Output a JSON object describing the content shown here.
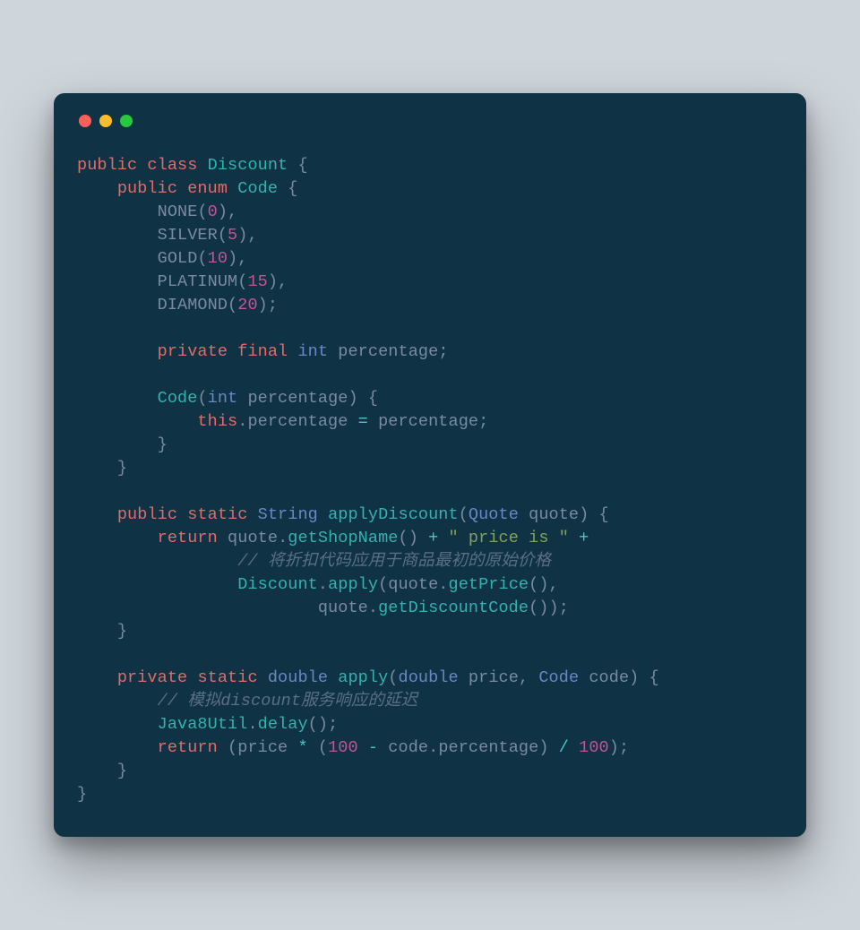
{
  "window": {
    "dots": {
      "red": "#ff5f56",
      "yellow": "#ffbd2e",
      "green": "#27c93f"
    }
  },
  "code": {
    "lines": [
      {
        "indent": 0,
        "tokens": [
          {
            "c": "kw",
            "t": "public"
          },
          {
            "c": "sp",
            "t": " "
          },
          {
            "c": "kw",
            "t": "class"
          },
          {
            "c": "sp",
            "t": " "
          },
          {
            "c": "cls",
            "t": "Discount"
          },
          {
            "c": "sp",
            "t": " "
          },
          {
            "c": "punct",
            "t": "{"
          }
        ]
      },
      {
        "indent": 1,
        "tokens": [
          {
            "c": "kw",
            "t": "public"
          },
          {
            "c": "sp",
            "t": " "
          },
          {
            "c": "kw",
            "t": "enum"
          },
          {
            "c": "sp",
            "t": " "
          },
          {
            "c": "cls",
            "t": "Code"
          },
          {
            "c": "sp",
            "t": " "
          },
          {
            "c": "punct",
            "t": "{"
          }
        ]
      },
      {
        "indent": 2,
        "tokens": [
          {
            "c": "enumc",
            "t": "NONE"
          },
          {
            "c": "punct",
            "t": "("
          },
          {
            "c": "num",
            "t": "0"
          },
          {
            "c": "punct",
            "t": "),"
          }
        ]
      },
      {
        "indent": 2,
        "tokens": [
          {
            "c": "enumc",
            "t": "SILVER"
          },
          {
            "c": "punct",
            "t": "("
          },
          {
            "c": "num",
            "t": "5"
          },
          {
            "c": "punct",
            "t": "),"
          }
        ]
      },
      {
        "indent": 2,
        "tokens": [
          {
            "c": "enumc",
            "t": "GOLD"
          },
          {
            "c": "punct",
            "t": "("
          },
          {
            "c": "num",
            "t": "10"
          },
          {
            "c": "punct",
            "t": "),"
          }
        ]
      },
      {
        "indent": 2,
        "tokens": [
          {
            "c": "enumc",
            "t": "PLATINUM"
          },
          {
            "c": "punct",
            "t": "("
          },
          {
            "c": "num",
            "t": "15"
          },
          {
            "c": "punct",
            "t": "),"
          }
        ]
      },
      {
        "indent": 2,
        "tokens": [
          {
            "c": "enumc",
            "t": "DIAMOND"
          },
          {
            "c": "punct",
            "t": "("
          },
          {
            "c": "num",
            "t": "20"
          },
          {
            "c": "punct",
            "t": ");"
          }
        ]
      },
      {
        "indent": 0,
        "tokens": [
          {
            "c": "sp",
            "t": " "
          }
        ]
      },
      {
        "indent": 2,
        "tokens": [
          {
            "c": "kw",
            "t": "private"
          },
          {
            "c": "sp",
            "t": " "
          },
          {
            "c": "kw",
            "t": "final"
          },
          {
            "c": "sp",
            "t": " "
          },
          {
            "c": "type",
            "t": "int"
          },
          {
            "c": "sp",
            "t": " "
          },
          {
            "c": "id",
            "t": "percentage"
          },
          {
            "c": "punct",
            "t": ";"
          }
        ]
      },
      {
        "indent": 0,
        "tokens": [
          {
            "c": "sp",
            "t": " "
          }
        ]
      },
      {
        "indent": 2,
        "tokens": [
          {
            "c": "cls",
            "t": "Code"
          },
          {
            "c": "punct",
            "t": "("
          },
          {
            "c": "type",
            "t": "int"
          },
          {
            "c": "sp",
            "t": " "
          },
          {
            "c": "id",
            "t": "percentage"
          },
          {
            "c": "punct",
            "t": ")"
          },
          {
            "c": "sp",
            "t": " "
          },
          {
            "c": "punct",
            "t": "{"
          }
        ]
      },
      {
        "indent": 3,
        "tokens": [
          {
            "c": "kw",
            "t": "this"
          },
          {
            "c": "punct",
            "t": "."
          },
          {
            "c": "id",
            "t": "percentage"
          },
          {
            "c": "sp",
            "t": " "
          },
          {
            "c": "op",
            "t": "="
          },
          {
            "c": "sp",
            "t": " "
          },
          {
            "c": "id",
            "t": "percentage"
          },
          {
            "c": "punct",
            "t": ";"
          }
        ]
      },
      {
        "indent": 2,
        "tokens": [
          {
            "c": "punct",
            "t": "}"
          }
        ]
      },
      {
        "indent": 1,
        "tokens": [
          {
            "c": "punct",
            "t": "}"
          }
        ]
      },
      {
        "indent": 0,
        "tokens": [
          {
            "c": "sp",
            "t": " "
          }
        ]
      },
      {
        "indent": 1,
        "tokens": [
          {
            "c": "kw",
            "t": "public"
          },
          {
            "c": "sp",
            "t": " "
          },
          {
            "c": "kw",
            "t": "static"
          },
          {
            "c": "sp",
            "t": " "
          },
          {
            "c": "type",
            "t": "String"
          },
          {
            "c": "sp",
            "t": " "
          },
          {
            "c": "fn",
            "t": "applyDiscount"
          },
          {
            "c": "punct",
            "t": "("
          },
          {
            "c": "type",
            "t": "Quote"
          },
          {
            "c": "sp",
            "t": " "
          },
          {
            "c": "id",
            "t": "quote"
          },
          {
            "c": "punct",
            "t": ")"
          },
          {
            "c": "sp",
            "t": " "
          },
          {
            "c": "punct",
            "t": "{"
          }
        ]
      },
      {
        "indent": 2,
        "tokens": [
          {
            "c": "kw",
            "t": "return"
          },
          {
            "c": "sp",
            "t": " "
          },
          {
            "c": "id",
            "t": "quote"
          },
          {
            "c": "punct",
            "t": "."
          },
          {
            "c": "fn",
            "t": "getShopName"
          },
          {
            "c": "punct",
            "t": "()"
          },
          {
            "c": "sp",
            "t": " "
          },
          {
            "c": "op",
            "t": "+"
          },
          {
            "c": "sp",
            "t": " "
          },
          {
            "c": "str",
            "t": "\" price is \""
          },
          {
            "c": "sp",
            "t": " "
          },
          {
            "c": "op",
            "t": "+"
          }
        ]
      },
      {
        "indent": 4,
        "tokens": [
          {
            "c": "cmt",
            "t": "// 将折扣代码应用于商品最初的原始价格"
          }
        ]
      },
      {
        "indent": 4,
        "tokens": [
          {
            "c": "cls",
            "t": "Discount"
          },
          {
            "c": "punct",
            "t": "."
          },
          {
            "c": "fn",
            "t": "apply"
          },
          {
            "c": "punct",
            "t": "("
          },
          {
            "c": "id",
            "t": "quote"
          },
          {
            "c": "punct",
            "t": "."
          },
          {
            "c": "fn",
            "t": "getPrice"
          },
          {
            "c": "punct",
            "t": "(),"
          }
        ]
      },
      {
        "indent": 6,
        "tokens": [
          {
            "c": "id",
            "t": "quote"
          },
          {
            "c": "punct",
            "t": "."
          },
          {
            "c": "fn",
            "t": "getDiscountCode"
          },
          {
            "c": "punct",
            "t": "());"
          }
        ]
      },
      {
        "indent": 1,
        "tokens": [
          {
            "c": "punct",
            "t": "}"
          }
        ]
      },
      {
        "indent": 0,
        "tokens": [
          {
            "c": "sp",
            "t": " "
          }
        ]
      },
      {
        "indent": 1,
        "tokens": [
          {
            "c": "kw",
            "t": "private"
          },
          {
            "c": "sp",
            "t": " "
          },
          {
            "c": "kw",
            "t": "static"
          },
          {
            "c": "sp",
            "t": " "
          },
          {
            "c": "type",
            "t": "double"
          },
          {
            "c": "sp",
            "t": " "
          },
          {
            "c": "fn",
            "t": "apply"
          },
          {
            "c": "punct",
            "t": "("
          },
          {
            "c": "type",
            "t": "double"
          },
          {
            "c": "sp",
            "t": " "
          },
          {
            "c": "id",
            "t": "price"
          },
          {
            "c": "punct",
            "t": ","
          },
          {
            "c": "sp",
            "t": " "
          },
          {
            "c": "type",
            "t": "Code"
          },
          {
            "c": "sp",
            "t": " "
          },
          {
            "c": "id",
            "t": "code"
          },
          {
            "c": "punct",
            "t": ")"
          },
          {
            "c": "sp",
            "t": " "
          },
          {
            "c": "punct",
            "t": "{"
          }
        ]
      },
      {
        "indent": 2,
        "tokens": [
          {
            "c": "cmt",
            "t": "// 模拟discount服务响应的延迟"
          }
        ]
      },
      {
        "indent": 2,
        "tokens": [
          {
            "c": "cls",
            "t": "Java8Util"
          },
          {
            "c": "punct",
            "t": "."
          },
          {
            "c": "fn",
            "t": "delay"
          },
          {
            "c": "punct",
            "t": "();"
          }
        ]
      },
      {
        "indent": 2,
        "tokens": [
          {
            "c": "kw",
            "t": "return"
          },
          {
            "c": "sp",
            "t": " "
          },
          {
            "c": "punct",
            "t": "("
          },
          {
            "c": "id",
            "t": "price"
          },
          {
            "c": "sp",
            "t": " "
          },
          {
            "c": "op",
            "t": "*"
          },
          {
            "c": "sp",
            "t": " "
          },
          {
            "c": "punct",
            "t": "("
          },
          {
            "c": "num",
            "t": "100"
          },
          {
            "c": "sp",
            "t": " "
          },
          {
            "c": "op",
            "t": "-"
          },
          {
            "c": "sp",
            "t": " "
          },
          {
            "c": "id",
            "t": "code"
          },
          {
            "c": "punct",
            "t": "."
          },
          {
            "c": "id",
            "t": "percentage"
          },
          {
            "c": "punct",
            "t": ")"
          },
          {
            "c": "sp",
            "t": " "
          },
          {
            "c": "op",
            "t": "/"
          },
          {
            "c": "sp",
            "t": " "
          },
          {
            "c": "num",
            "t": "100"
          },
          {
            "c": "punct",
            "t": ");"
          }
        ]
      },
      {
        "indent": 1,
        "tokens": [
          {
            "c": "punct",
            "t": "}"
          }
        ]
      },
      {
        "indent": 0,
        "tokens": [
          {
            "c": "punct",
            "t": "}"
          }
        ]
      }
    ],
    "indentUnit": "    "
  }
}
